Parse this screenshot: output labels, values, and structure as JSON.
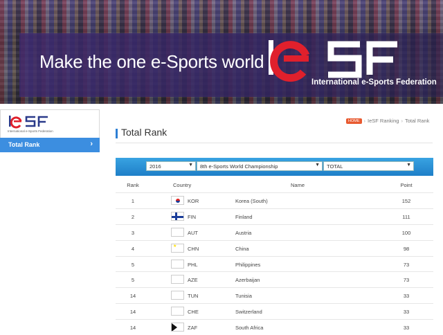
{
  "banner": {
    "tagline": "Make the one e-Sports world",
    "logo_text": "IeSF",
    "logo_subtitle": "International e-Sports Federation"
  },
  "sidebar": {
    "logo_text": "IeSF",
    "logo_subtitle": "International e-Sports Federation",
    "items": [
      {
        "label": "Total Rank",
        "active": true
      }
    ]
  },
  "breadcrumb": {
    "home_label": "HOME",
    "items": [
      "IeSF Ranking",
      "Total Rank"
    ]
  },
  "page_title": "Total Rank",
  "filters": {
    "year": "2016",
    "event": "8th e-Sports World Championship",
    "category": "TOTAL"
  },
  "table": {
    "columns": [
      "Rank",
      "Country",
      "Name",
      "Point"
    ],
    "rows": [
      {
        "rank": "1",
        "code": "KOR",
        "name": "Korea (South)",
        "point": "152",
        "flag": "kor"
      },
      {
        "rank": "2",
        "code": "FIN",
        "name": "Finland",
        "point": "111",
        "flag": "fin"
      },
      {
        "rank": "3",
        "code": "AUT",
        "name": "Austria",
        "point": "100",
        "flag": "aut"
      },
      {
        "rank": "4",
        "code": "CHN",
        "name": "China",
        "point": "98",
        "flag": "chn"
      },
      {
        "rank": "5",
        "code": "PHL",
        "name": "Philippines",
        "point": "73",
        "flag": "phl"
      },
      {
        "rank": "5",
        "code": "AZE",
        "name": "Azerbaijan",
        "point": "73",
        "flag": "aze"
      },
      {
        "rank": "14",
        "code": "TUN",
        "name": "Tunisia",
        "point": "33",
        "flag": "tun"
      },
      {
        "rank": "14",
        "code": "CHE",
        "name": "Switzerland",
        "point": "33",
        "flag": "che"
      },
      {
        "rank": "14",
        "code": "ZAF",
        "name": "South Africa",
        "point": "33",
        "flag": "zaf"
      }
    ]
  },
  "colors": {
    "accent": "#3c8ee0",
    "filter_bar": "#1e7fc8",
    "logo_red": "#e0202c"
  }
}
